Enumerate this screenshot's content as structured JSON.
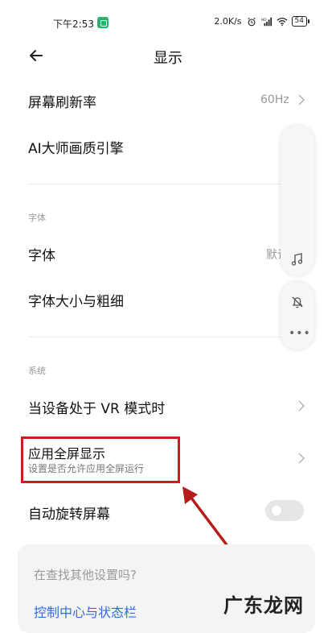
{
  "status_bar": {
    "time": "下午2:53",
    "net_speed": "2.0K/s",
    "battery": "54",
    "icons": [
      "wechat-icon",
      "alarm-icon",
      "hd-signal-icon",
      "wifi-icon",
      "battery-icon"
    ]
  },
  "header": {
    "title": "显示",
    "back_icon": "arrow-left-icon"
  },
  "rows": {
    "refresh_rate": {
      "label": "屏幕刷新率",
      "value": "60Hz"
    },
    "ai_engine": {
      "label": "AI大师画质引擎"
    },
    "font": {
      "label": "字体",
      "value": "默认"
    },
    "font_size": {
      "label": "字体大小与粗细"
    },
    "vr_mode": {
      "label": "当设备处于 VR 模式时"
    },
    "fullscreen": {
      "label": "应用全屏显示",
      "subtitle": "设置是否允许应用全屏运行"
    },
    "auto_rotate": {
      "label": "自动旋转屏幕",
      "state": "off"
    }
  },
  "sections": {
    "font_header": "字体",
    "system_header": "系统"
  },
  "search_card": {
    "question": "在查找其他设置吗?",
    "link": "控制中心与状态栏"
  },
  "watermark": "广东龙网",
  "colors": {
    "highlight": "#c81e1e",
    "link": "#2f6de1",
    "toggle_off": "#e6e6e6",
    "annotation_arrow": "#b71c1c"
  },
  "floating_panel": {
    "icons": [
      "music-note-icon",
      "mute-bell-icon",
      "more-dots-icon"
    ]
  }
}
